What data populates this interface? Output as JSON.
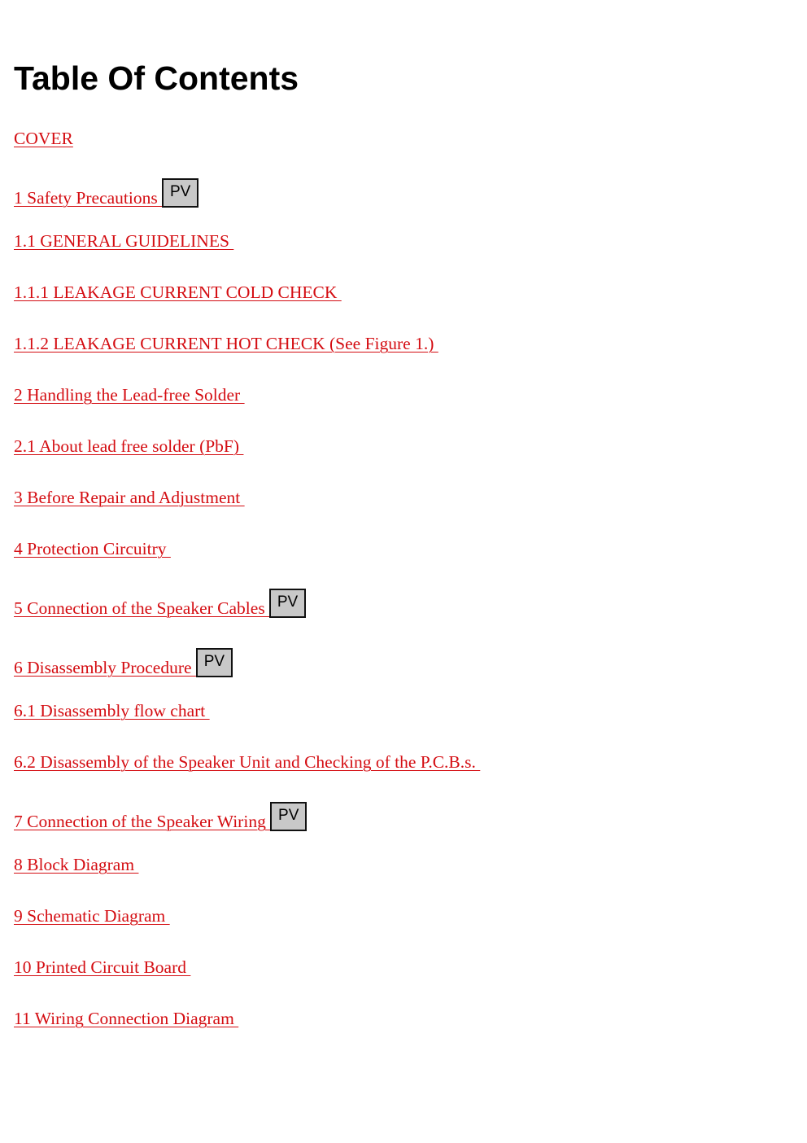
{
  "document": {
    "title": "Table Of Contents",
    "link_color": "#d40d12",
    "entries": [
      {
        "label": "COVER",
        "pv": null
      },
      {
        "label": "1 Safety Precautions ",
        "pv": "PV"
      },
      {
        "label": "1.1 GENERAL GUIDELINES ",
        "pv": null
      },
      {
        "label": "1.1.1 LEAKAGE CURRENT COLD CHECK ",
        "pv": null
      },
      {
        "label": "1.1.2 LEAKAGE CURRENT HOT CHECK (See Figure 1.) ",
        "pv": null
      },
      {
        "label": "2 Handling the Lead-free Solder ",
        "pv": null
      },
      {
        "label": "2.1 About lead free solder (PbF) ",
        "pv": null
      },
      {
        "label": "3 Before Repair and Adjustment ",
        "pv": null
      },
      {
        "label": "4 Protection Circuitry ",
        "pv": null
      },
      {
        "label": "5 Connection of the Speaker Cables ",
        "pv": "PV"
      },
      {
        "label": "6 Disassembly Procedure ",
        "pv": "PV"
      },
      {
        "label": "6.1 Disassembly flow chart ",
        "pv": null
      },
      {
        "label": "6.2 Disassembly of the Speaker Unit and Checking of the P.C.B.s. ",
        "pv": null
      },
      {
        "label": "7 Connection of the Speaker Wiring ",
        "pv": "PV"
      },
      {
        "label": "8 Block Diagram ",
        "pv": null
      },
      {
        "label": "9 Schematic Diagram ",
        "pv": null
      },
      {
        "label": "10 Printed Circuit Board ",
        "pv": null
      },
      {
        "label": "11 Wiring Connection Diagram ",
        "pv": null
      }
    ]
  }
}
